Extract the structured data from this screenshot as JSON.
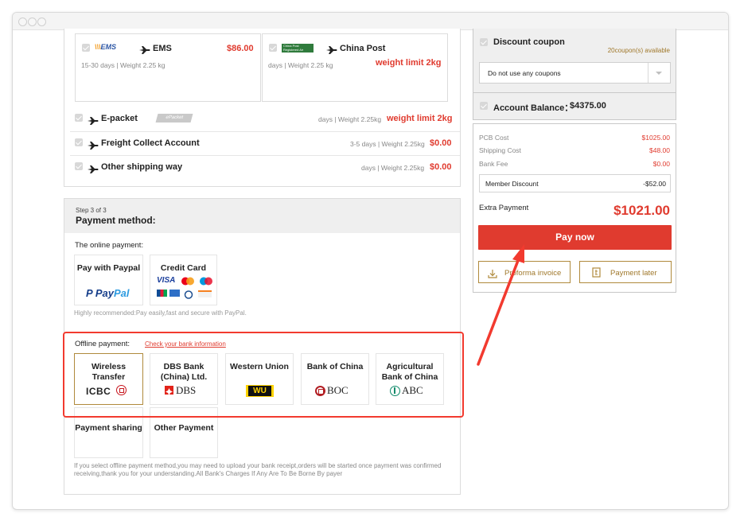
{
  "shipping": {
    "options_top": [
      {
        "name": "EMS",
        "logo_text": "EMS",
        "desc": "15-30 days | Weight 2.25 kg",
        "price": "$86.00"
      },
      {
        "name": "China Post",
        "logo_text": "China Post Registered Air",
        "desc": "days | Weight 2.25 kg",
        "price": "weight limit 2kg"
      }
    ],
    "rows": [
      {
        "name": "E-packet",
        "logo_text": "ePacket",
        "desc": "days | Weight 2.25kg",
        "price": "weight limit 2kg"
      },
      {
        "name": "Freight Collect Account",
        "desc": "3-5 days | Weight 2.25kg",
        "price": "$0.00"
      },
      {
        "name": "Other shipping way",
        "desc": "days | Weight 2.25kg",
        "price": "$0.00"
      }
    ]
  },
  "payment": {
    "step": "Step 3 of 3",
    "title": "Payment method:",
    "online_label": "The online payment:",
    "online": [
      {
        "label": "Pay with Paypal",
        "brand": "PayPal"
      },
      {
        "label": "Credit Card",
        "brand": "VISA"
      }
    ],
    "recommend": "Highly recommended:Pay easily,fast and secure with PayPal.",
    "offline_label": "Offline payment:",
    "bank_link": "Check your bank information",
    "offline": [
      {
        "label": "Wireless Transfer",
        "logo": "ICBC"
      },
      {
        "label": "DBS Bank (China) Ltd.",
        "logo": "DBS"
      },
      {
        "label": "Western Union",
        "logo": "WU"
      },
      {
        "label": "Bank of China",
        "logo": "BOC"
      },
      {
        "label": "Agricultural Bank of China",
        "logo": "ABC"
      }
    ],
    "more": [
      {
        "label": "Payment sharing"
      },
      {
        "label": "Other Payment"
      }
    ],
    "note": "If you select offline payment method,you may need to upload your bank receipt,orders will be started once payment was confirmed receiving,thank you for your understanding.All Bank's Charges If Any Are To Be Borne By payer"
  },
  "sidebar": {
    "coupon_title": "Discount coupon",
    "coupon_available": "20coupon(s) available",
    "coupon_select": "Do not use any coupons",
    "balance_label": "Account Balance：",
    "balance_value": "$4375.00",
    "costs": [
      {
        "label": "PCB Cost",
        "value": "$1025.00"
      },
      {
        "label": "Shipping Cost",
        "value": "$48.00"
      },
      {
        "label": "Bank Fee",
        "value": "$0.00"
      }
    ],
    "member_discount_label": "Member Discount",
    "member_discount_value": "-$52.00",
    "extra_payment_label": "Extra Payment",
    "extra_payment_value": "$1021.00",
    "pay_now": "Pay now",
    "proforma": "Proforma invoice",
    "pay_later": "Payment later"
  },
  "colors": {
    "accent_red": "#e03b2f",
    "gold": "#b08a3c",
    "annotation_red": "#f23a2f"
  }
}
